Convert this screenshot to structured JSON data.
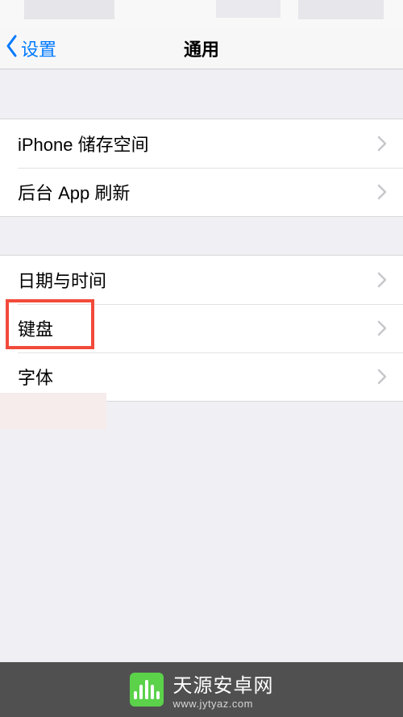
{
  "nav": {
    "back_label": "设置",
    "title": "通用"
  },
  "group1": {
    "items": [
      {
        "label": "iPhone 储存空间"
      },
      {
        "label": "后台 App 刷新"
      }
    ]
  },
  "group2": {
    "items": [
      {
        "label": "日期与时间"
      },
      {
        "label": "键盘"
      },
      {
        "label": "字体"
      }
    ]
  },
  "watermark": {
    "title": "天源安卓网",
    "url": "www.jytyaz.com"
  },
  "colors": {
    "link": "#007aff",
    "highlight": "#f24a3a",
    "bg": "#efeff4",
    "logo": "#5bd24a"
  }
}
